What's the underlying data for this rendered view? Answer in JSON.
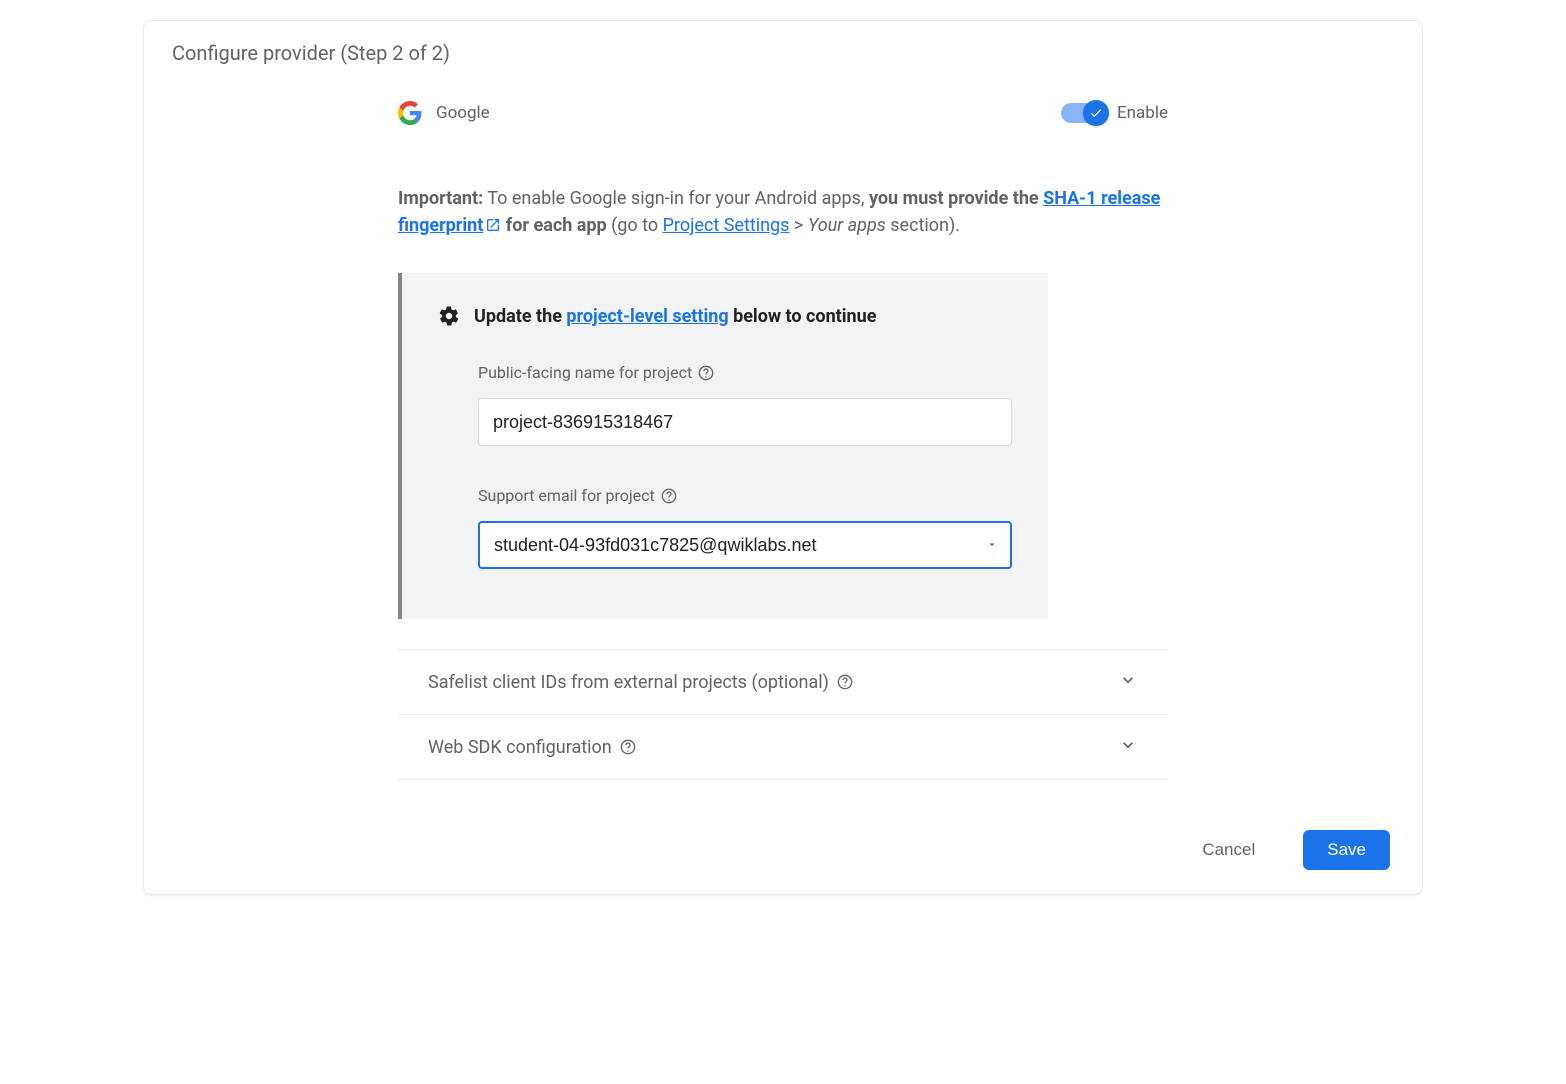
{
  "header": {
    "title": "Configure provider (Step 2 of 2)"
  },
  "provider": {
    "name": "Google",
    "toggle_label": "Enable"
  },
  "important": {
    "label": "Important:",
    "text1": " To enable Google sign-in for your Android apps, ",
    "bold1": "you must provide the ",
    "link1": "SHA-1 release fingerprint",
    "bold2": " for each app",
    "text2": " (go to ",
    "link2": "Project Settings",
    "text3": " > ",
    "italic1": "Your apps",
    "text4": " section)."
  },
  "panel": {
    "head_pre": "Update the ",
    "head_link": "project-level setting",
    "head_post": " below to continue",
    "name_label": "Public-facing name for project",
    "name_value": "project-836915318467",
    "email_label": "Support email for project",
    "email_value": "student-04-93fd031c7825@qwiklabs.net"
  },
  "sections": {
    "safelist": "Safelist client IDs from external projects (optional)",
    "websdk": "Web SDK configuration"
  },
  "actions": {
    "cancel": "Cancel",
    "save": "Save"
  }
}
